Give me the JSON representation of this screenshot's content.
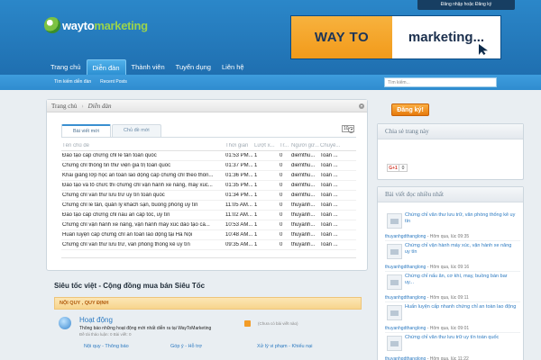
{
  "header": {
    "login_label": "Đăng nhập hoặc Đăng ký",
    "logo": {
      "way": "wayto",
      "marketing": "marketing"
    },
    "banner": {
      "left": "WAY TO",
      "right": "marketing..."
    }
  },
  "nav": {
    "items": [
      "Trang chủ",
      "Diễn đàn",
      "Thành viên",
      "Tuyển dụng",
      "Liên hệ"
    ],
    "active": "Diễn đàn"
  },
  "subnav": {
    "links": [
      "Tìm kiếm diễn đàn",
      "Recent Posts"
    ]
  },
  "search": {
    "placeholder": "Tìm kiếm..."
  },
  "breadcrumb": {
    "home": "Trang chủ",
    "current": "Diễn đàn"
  },
  "tabs": [
    "Bài viết mới",
    "Chủ đề mới"
  ],
  "count_select": "10",
  "table": {
    "headers": [
      "Tên chủ đề",
      "Thời gian",
      "Lượt x...",
      "Tr...",
      "Người gử...",
      "Chuyê..."
    ],
    "rows": [
      [
        "Đào tạo cấp chứng chỉ lễ tân toàn quốc",
        "01:53 PM...",
        "1",
        "0",
        "diemthu...",
        "Toàn ..."
      ],
      [
        "Chứng chỉ thông tin thư viện giá trị toàn quốc",
        "01:37 PM...",
        "1",
        "0",
        "diemthu...",
        "Toàn ..."
      ],
      [
        "Khai giảng lớp học an toàn lao động cấp chứng chỉ theo thôn...",
        "01:36 PM...",
        "1",
        "0",
        "diemthu...",
        "Toàn ..."
      ],
      [
        "Đào tạo và tổ chức thi chứng chỉ vận hành xe nâng, máy xúc...",
        "01:35 PM...",
        "1",
        "0",
        "diemthu...",
        "Toàn ..."
      ],
      [
        "Chứng chỉ văn thư lưu trữ uy tín toàn quốc",
        "01:34 PM...",
        "1",
        "0",
        "diemthu...",
        "Toàn ..."
      ],
      [
        "Chứng chỉ lễ tân, quản lý khách sạn, buồng phòng uy tín",
        "11:05 AM...",
        "1",
        "0",
        "thuyanh...",
        "Toàn ..."
      ],
      [
        "Đào tạo cấp chứng chỉ nấu ăn cấp tốc, uy tín",
        "11:02 AM...",
        "1",
        "0",
        "thuyanh...",
        "Toàn ..."
      ],
      [
        "Chứng chỉ vận hành xe nâng, vận hành máy xúc đào tạo cấ...",
        "10:53 AM...",
        "1",
        "0",
        "thuyanh...",
        "Toàn ..."
      ],
      [
        "Huấn luyện cấp chứng chỉ an toàn lao động tại Hà Nội",
        "10:48 AM...",
        "1",
        "0",
        "thuyanh...",
        "Toàn ..."
      ],
      [
        "Chứng chỉ văn thư lưu trữ, văn phòng thống kê uy tín",
        "09:35 AM...",
        "1",
        "0",
        "thuyanh...",
        "Toàn ..."
      ]
    ]
  },
  "section_title": "Siêu tốc việt - Cộng đồng mua bán Siêu Tốc",
  "faq_bar": "NỘI QUY , QUY ĐỊNH",
  "forum": {
    "name": "Hoạt động",
    "desc": "Thông báo những hoạt động mới nhất diễn ra tại WayToMarketing",
    "meta": "Đề tài thảo luận: 0   Bài viết: 0",
    "last": "(Chưa có bài viết nào)"
  },
  "sublinks": [
    "Nội quy - Thông báo",
    "Góp ý - Hỗ trợ",
    "Xử lý vi phạm - Khiếu nại"
  ],
  "sidebar": {
    "register": "Đăng ký!",
    "share_title": "Chia sẻ trang này",
    "gplus": "G+1",
    "gcount": "0",
    "popular_title": "Bài viết đọc nhiều nhất",
    "popular": [
      {
        "title": "Chứng chỉ văn thư lưu trữ, văn phòng thống kê uy tín",
        "meta_user": "thuyanhgdthanglong",
        "meta_rest": " - Hôm qua, lúc 09:35"
      },
      {
        "title": "Chứng chỉ vận hành máy xúc, vận hành xe nâng uy tín",
        "meta_user": "thuyanhgdthanglong",
        "meta_rest": " - Hôm qua, lúc 09:16"
      },
      {
        "title": "Chứng chỉ nấu ăn, cơ khí, may, buồng bàn bar uy...",
        "meta_user": "thuyanhgdthanglong",
        "meta_rest": " - Hôm qua, lúc 09:11"
      },
      {
        "title": "Huấn luyện cấp nhanh chứng chỉ an toàn lao động",
        "meta_user": "thuyanhgdthanglong",
        "meta_rest": " - Hôm qua, lúc 09:01"
      },
      {
        "title": "Chứng chỉ văn thư lưu trữ uy tín toàn quốc",
        "meta_user": "thuyanhgdthanglong",
        "meta_rest": " - Hôm qua, lúc 11:22"
      }
    ]
  }
}
